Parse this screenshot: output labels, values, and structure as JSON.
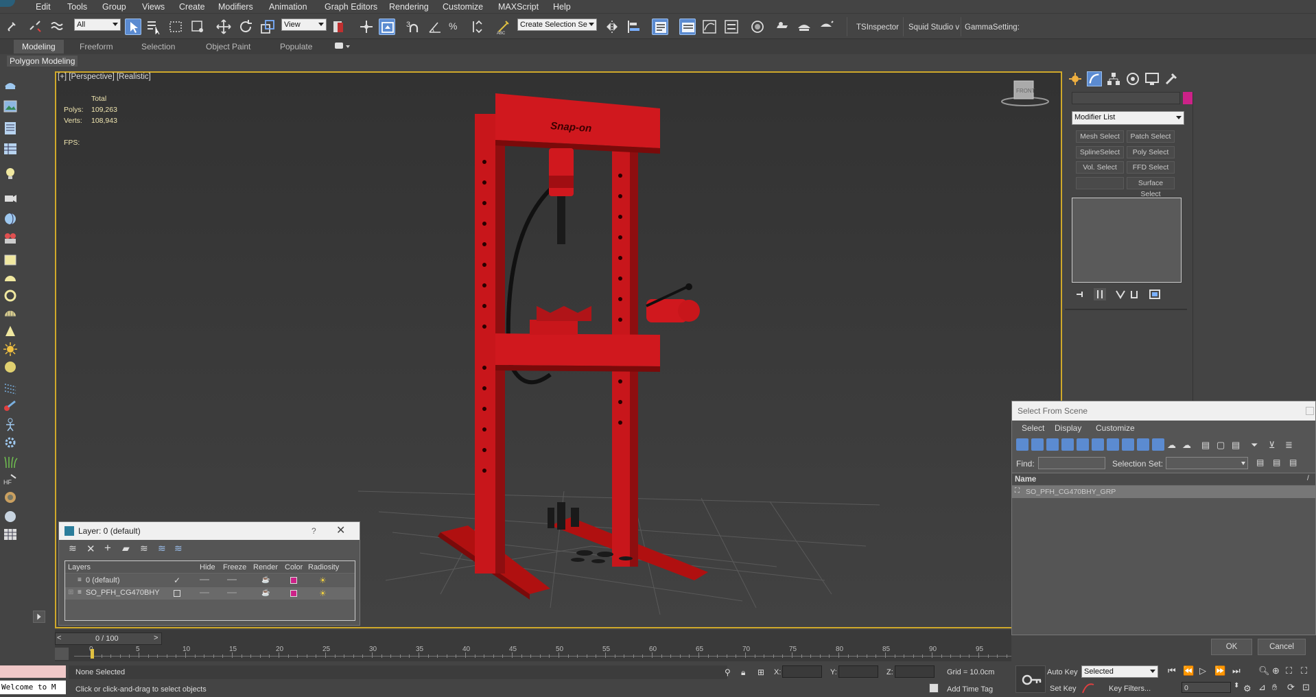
{
  "menu": [
    "Edit",
    "Tools",
    "Group",
    "Views",
    "Create",
    "Modifiers",
    "Animation",
    "Graph Editors",
    "Rendering",
    "Customize",
    "MAXScript",
    "Help"
  ],
  "toolbar": {
    "filter_select": "All",
    "ref_coord": "View",
    "selection_set": "Create Selection Se",
    "plugin_tabs": [
      "TSInspector",
      "Squid Studio v",
      "GammaSetting:"
    ]
  },
  "ribbon": {
    "tabs": [
      "Modeling",
      "Freeform",
      "Selection",
      "Object Paint",
      "Populate"
    ],
    "active": "Modeling",
    "subtab": "Polygon Modeling"
  },
  "viewport": {
    "label": "[+] [Perspective] [Realistic]",
    "stats_header": "Total",
    "polys_label": "Polys:",
    "polys": "109,263",
    "verts_label": "Verts:",
    "verts": "108,943",
    "fps_label": "FPS:",
    "brand_text": "Snap-on",
    "accent": "#c8161b"
  },
  "command_panel": {
    "modifier_list": "Modifier List",
    "buttons": [
      "Mesh Select",
      "Patch Select",
      "SplineSelect",
      "Poly Select",
      "Vol. Select",
      "FFD Select",
      "",
      "Surface Select"
    ],
    "color_swatch": "#cc2288"
  },
  "layer_dialog": {
    "title": "Layer: 0 (default)",
    "help": "?",
    "columns": [
      "Layers",
      "Hide",
      "Freeze",
      "Render",
      "Color",
      "Radiosity"
    ],
    "rows": [
      {
        "name": "0 (default)",
        "active": true,
        "color": "#cc2288"
      },
      {
        "name": "SO_PFH_CG470BHY",
        "active": false,
        "color": "#cc2288"
      }
    ]
  },
  "select_from_scene": {
    "title": "Select From Scene",
    "menu": [
      "Select",
      "Display",
      "Customize"
    ],
    "find_label": "Find:",
    "selection_set_label": "Selection Set:",
    "column": "Name",
    "items": [
      "SO_PFH_CG470BHY_GRP"
    ],
    "ok": "OK",
    "cancel": "Cancel"
  },
  "timeline": {
    "frame_display": "0 / 100",
    "ticks": [
      "0",
      "5",
      "10",
      "15",
      "20",
      "25",
      "30",
      "35",
      "40",
      "45",
      "50",
      "55",
      "60",
      "65",
      "70",
      "75",
      "80",
      "85",
      "90",
      "95"
    ]
  },
  "status": {
    "maxscript_text": "Welcome to M",
    "selection": "None Selected",
    "prompt": "Click or click-and-drag to select objects",
    "x_label": "X:",
    "y_label": "Y:",
    "z_label": "Z:",
    "grid": "Grid = 10.0cm",
    "add_time_tag": "Add Time Tag",
    "auto_key": "Auto Key",
    "set_key": "Set Key",
    "key_mode": "Selected",
    "key_filters": "Key Filters...",
    "frame": "0"
  }
}
